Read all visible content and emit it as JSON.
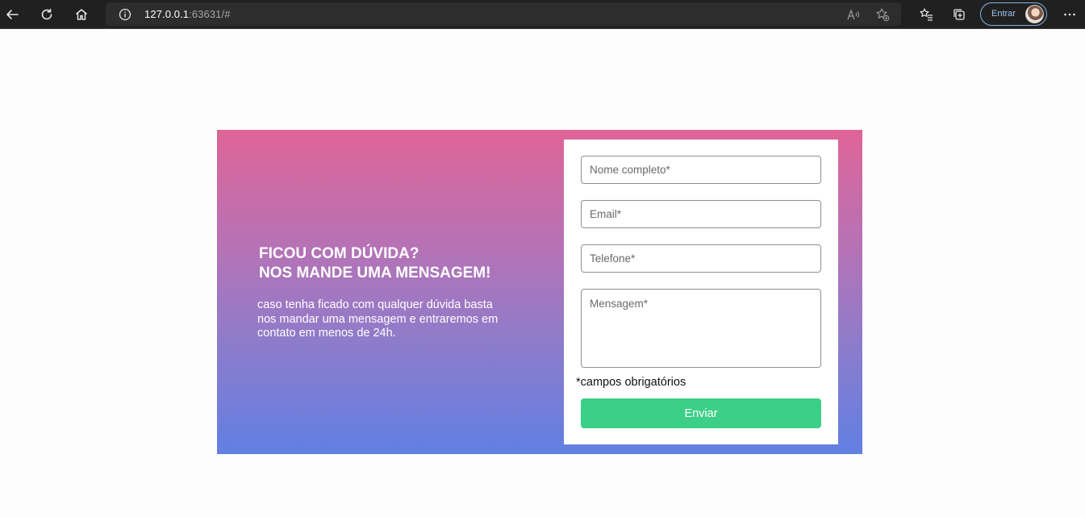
{
  "browser": {
    "url_host": "127.0.0.1",
    "url_rest": ":63631/#",
    "profile_label": "Entrar"
  },
  "contact": {
    "heading_line1": "FICOU COM DÚVIDA?",
    "heading_line2": "NOS MANDE UMA MENSAGEM!",
    "description": "caso tenha ficado com qualquer dúvida basta nos mandar uma mensagem e entraremos em contato em menos de 24h.",
    "form": {
      "name_placeholder": "Nome completo*",
      "email_placeholder": "Email*",
      "phone_placeholder": "Telefone*",
      "message_placeholder": "Mensagem*",
      "required_note": "*campos obrigatórios",
      "submit_label": "Enviar"
    }
  },
  "colors": {
    "gradient_top": "#df6497",
    "gradient_bottom": "#617fe3",
    "submit_button": "#3ccf88"
  }
}
